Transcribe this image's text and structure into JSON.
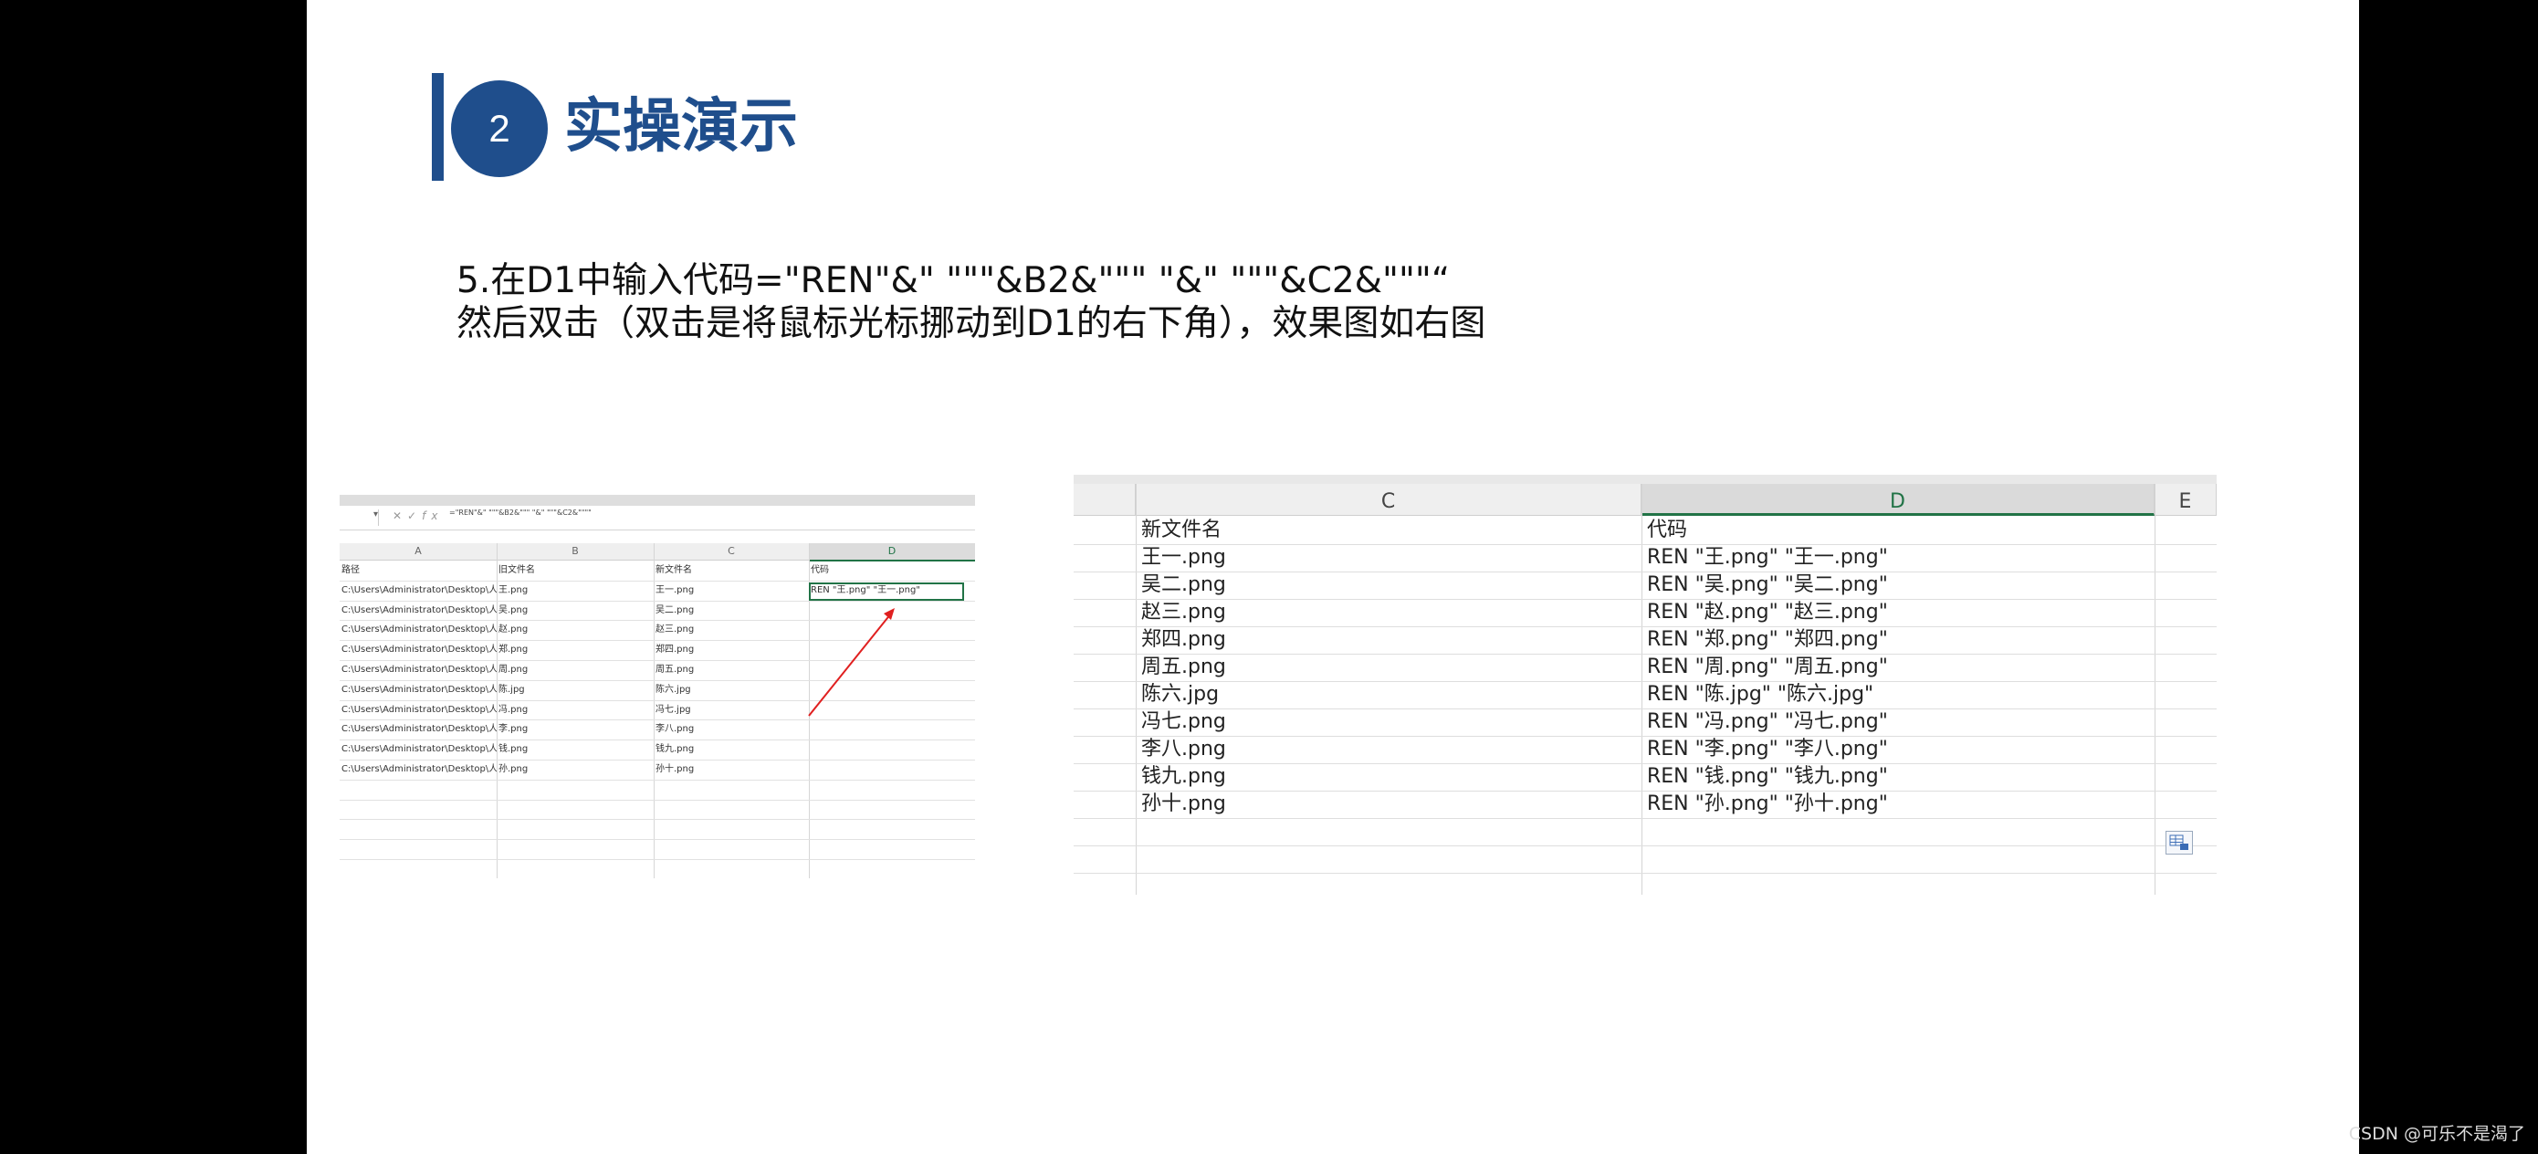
{
  "slide": {
    "section_number": "2",
    "section_title": "实操演示",
    "instruction_line1": "5.在D1中输入代码=\"REN\"&\" \"\"\"&B2&\"\"\" \"&\" \"\"\"&C2&\"\"\"“",
    "instruction_line2": "然后双击（双击是将鼠标光标挪动到D1的右下角），效果图如右图",
    "accent_color": "#1f4e8c"
  },
  "small_sheet": {
    "formula_text": "=\"REN\"&\" \"\"\"&B2&\"\"\" \"&\" \"\"\"&C2&\"\"\"\"",
    "columns": [
      "A",
      "B",
      "C",
      "D"
    ],
    "header_row": [
      "路径",
      "旧文件名",
      "新文件名",
      "代码"
    ],
    "rows": [
      [
        "C:\\Users\\Administrator\\Desktop\\人员图像\\王.png",
        "王.png",
        "王一.png",
        "REN \"王.png\" \"王一.png\""
      ],
      [
        "C:\\Users\\Administrator\\Desktop\\人员图像\\吴.png",
        "吴.png",
        "吴二.png",
        ""
      ],
      [
        "C:\\Users\\Administrator\\Desktop\\人员图像\\赵.png",
        "赵.png",
        "赵三.png",
        ""
      ],
      [
        "C:\\Users\\Administrator\\Desktop\\人员图像\\郑.png",
        "郑.png",
        "郑四.png",
        ""
      ],
      [
        "C:\\Users\\Administrator\\Desktop\\人员图像\\周.png",
        "周.png",
        "周五.png",
        ""
      ],
      [
        "C:\\Users\\Administrator\\Desktop\\人员图像\\陈.jpg",
        "陈.jpg",
        "陈六.jpg",
        ""
      ],
      [
        "C:\\Users\\Administrator\\Desktop\\人员图像\\冯.png",
        "冯.png",
        "冯七.jpg",
        ""
      ],
      [
        "C:\\Users\\Administrator\\Desktop\\人员图像\\李.png",
        "李.png",
        "李八.png",
        ""
      ],
      [
        "C:\\Users\\Administrator\\Desktop\\人员图像\\钱.png",
        "钱.png",
        "钱九.png",
        ""
      ],
      [
        "C:\\Users\\Administrator\\Desktop\\人员图像\\孙.png",
        "孙.png",
        "孙十.png",
        ""
      ]
    ]
  },
  "big_sheet": {
    "columns": [
      "C",
      "D",
      "E"
    ],
    "header_row": [
      "新文件名",
      "代码"
    ],
    "rows": [
      [
        "王一.png",
        "REN \"王.png\"  \"王一.png\""
      ],
      [
        "吴二.png",
        "REN \"吴.png\"  \"吴二.png\""
      ],
      [
        "赵三.png",
        "REN \"赵.png\"  \"赵三.png\""
      ],
      [
        "郑四.png",
        "REN \"郑.png\"  \"郑四.png\""
      ],
      [
        "周五.png",
        "REN \"周.png\"  \"周五.png\""
      ],
      [
        "陈六.jpg",
        "REN \"陈.jpg\"  \"陈六.jpg\""
      ],
      [
        "冯七.png",
        "REN \"冯.png\"  \"冯七.png\""
      ],
      [
        "李八.png",
        "REN \"李.png\"  \"李八.png\""
      ],
      [
        "钱九.png",
        "REN \"钱.png\"  \"钱九.png\""
      ],
      [
        "孙十.png",
        "REN \"孙.png\"  \"孙十.png\""
      ]
    ],
    "paste_options_icon": "autofill-options-icon"
  },
  "watermark": "CSDN @可乐不是渴了"
}
